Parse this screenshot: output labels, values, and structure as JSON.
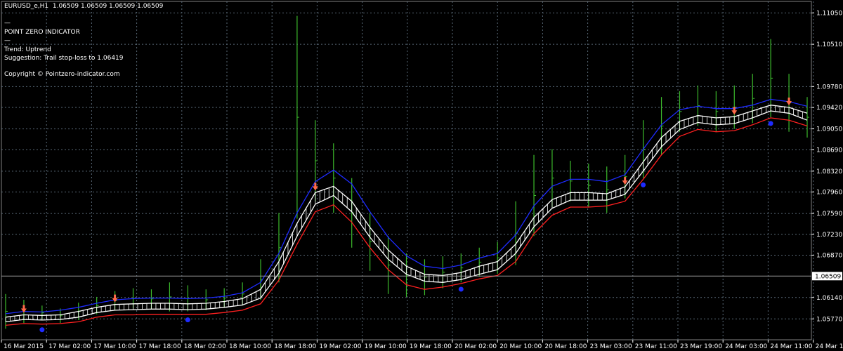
{
  "header": {
    "symbol_line": "EURUSD_e,H1  1.06509 1.06509 1.06509 1.06509",
    "sep1": "—",
    "indicator_name": "POINT ZERO INDICATOR",
    "sep2": "—",
    "trend": "Trend: Uptrend",
    "suggestion": "Suggestion: Trail stop-loss to 1.06419",
    "copyright": "Copyright © Pointzero-indicator.com"
  },
  "colors": {
    "background": "#000000",
    "grid": "#5a6a78",
    "bars": "#3cba2c",
    "upper_band": "#1e2bff",
    "lower_band": "#ff2020",
    "channel": "#ffffff",
    "up_arrow": "#ff6a4a",
    "down_dot": "#1e2bff",
    "axis_text": "#ffffff"
  },
  "chart_data": {
    "type": "line",
    "title": "EURUSD_e,H1",
    "current_price": 1.06509,
    "current_price_label": "1.06509",
    "ylim": [
      1.0541,
      1.1125
    ],
    "yticks": [
      "1.11050",
      "1.10510",
      "1.09780",
      "1.09420",
      "1.09050",
      "1.08690",
      "1.08320",
      "1.07960",
      "1.07590",
      "1.07230",
      "1.06870",
      "1.06140",
      "1.05770"
    ],
    "ytick_values": [
      1.1105,
      1.1051,
      1.0978,
      1.0942,
      1.0905,
      1.0869,
      1.0832,
      1.0796,
      1.0759,
      1.0723,
      1.0687,
      1.0614,
      1.0577
    ],
    "xticks": [
      "16 Mar 2015",
      "17 Mar 02:00",
      "17 Mar 10:00",
      "17 Mar 18:00",
      "18 Mar 02:00",
      "18 Mar 10:00",
      "18 Mar 18:00",
      "19 Mar 02:00",
      "19 Mar 10:00",
      "19 Mar 18:00",
      "20 Mar 02:00",
      "20 Mar 10:00",
      "20 Mar 18:00",
      "23 Mar 03:00",
      "23 Mar 11:00",
      "23 Mar 19:00",
      "24 Mar 03:00",
      "24 Mar 11:00",
      "24 Mar 19"
    ],
    "series": [
      {
        "name": "Upper band",
        "values": [
          1.0586,
          1.059,
          1.0589,
          1.0592,
          1.0597,
          1.0604,
          1.061,
          1.0612,
          1.0613,
          1.0613,
          1.0612,
          1.0613,
          1.0616,
          1.0622,
          1.064,
          1.069,
          1.076,
          1.0814,
          1.0834,
          1.081,
          1.0762,
          1.0718,
          1.0686,
          1.0668,
          1.0664,
          1.067,
          1.0682,
          1.069,
          1.0722,
          1.0772,
          1.0806,
          1.0818,
          1.0818,
          1.0814,
          1.0826,
          1.087,
          1.0912,
          1.0938,
          1.0944,
          1.094,
          1.094,
          1.0946,
          1.0956,
          1.0952,
          1.0944
        ]
      },
      {
        "name": "Channel upper",
        "values": [
          1.058,
          1.0584,
          1.0583,
          1.0584,
          1.059,
          1.0597,
          1.0602,
          1.0603,
          1.0604,
          1.0604,
          1.0603,
          1.0604,
          1.0607,
          1.0612,
          1.0628,
          1.0676,
          1.0742,
          1.0795,
          1.0806,
          1.078,
          1.0735,
          1.0696,
          1.0668,
          1.0654,
          1.0652,
          1.0657,
          1.0668,
          1.0676,
          1.0706,
          1.0752,
          1.0783,
          1.0795,
          1.0795,
          1.0793,
          1.0805,
          1.0848,
          1.089,
          1.0918,
          1.0928,
          1.0924,
          1.0926,
          1.0936,
          1.0946,
          1.0942,
          1.0932
        ]
      },
      {
        "name": "Channel lower",
        "values": [
          1.0572,
          1.0576,
          1.0575,
          1.0576,
          1.058,
          1.0588,
          1.0592,
          1.0593,
          1.0594,
          1.0594,
          1.0593,
          1.0594,
          1.0597,
          1.0601,
          1.0613,
          1.0656,
          1.072,
          1.0775,
          1.079,
          1.0762,
          1.0718,
          1.068,
          1.0654,
          1.0642,
          1.064,
          1.0645,
          1.0654,
          1.0662,
          1.069,
          1.0736,
          1.0768,
          1.0782,
          1.0782,
          1.0782,
          1.0792,
          1.0832,
          1.0874,
          1.0904,
          1.0916,
          1.0912,
          1.0914,
          1.0924,
          1.0936,
          1.0932,
          1.092
        ]
      },
      {
        "name": "Lower band",
        "values": [
          1.0566,
          1.0569,
          1.0568,
          1.0569,
          1.0572,
          1.058,
          1.0584,
          1.0584,
          1.0585,
          1.0585,
          1.0585,
          1.0585,
          1.0588,
          1.0592,
          1.0603,
          1.0644,
          1.0706,
          1.0762,
          1.0774,
          1.0744,
          1.07,
          1.0662,
          1.0636,
          1.0628,
          1.0632,
          1.0638,
          1.0646,
          1.0652,
          1.0676,
          1.0724,
          1.0756,
          1.077,
          1.077,
          1.0772,
          1.078,
          1.0818,
          1.086,
          1.0892,
          1.0904,
          1.09,
          1.0902,
          1.0912,
          1.0924,
          1.092,
          1.091
        ]
      }
    ],
    "bars": [
      {
        "high": 1.062,
        "low": 1.056
      },
      {
        "high": 1.061,
        "low": 1.057
      },
      {
        "high": 1.06,
        "low": 1.0575
      },
      {
        "high": 1.0595,
        "low": 1.057
      },
      {
        "high": 1.0605,
        "low": 1.0575
      },
      {
        "high": 1.0615,
        "low": 1.0585
      },
      {
        "high": 1.0625,
        "low": 1.0592
      },
      {
        "high": 1.063,
        "low": 1.0595
      },
      {
        "high": 1.0628,
        "low": 1.0595
      },
      {
        "high": 1.064,
        "low": 1.059
      },
      {
        "high": 1.0635,
        "low": 1.059
      },
      {
        "high": 1.0628,
        "low": 1.0592
      },
      {
        "high": 1.063,
        "low": 1.0596
      },
      {
        "high": 1.064,
        "low": 1.06
      },
      {
        "high": 1.068,
        "low": 1.061
      },
      {
        "high": 1.076,
        "low": 1.064
      },
      {
        "high": 1.11,
        "low": 1.075
      },
      {
        "high": 1.092,
        "low": 1.078
      },
      {
        "high": 1.088,
        "low": 1.076
      },
      {
        "high": 1.082,
        "low": 1.07
      },
      {
        "high": 1.076,
        "low": 1.066
      },
      {
        "high": 1.072,
        "low": 1.062
      },
      {
        "high": 1.069,
        "low": 1.0615
      },
      {
        "high": 1.068,
        "low": 1.0618
      },
      {
        "high": 1.0685,
        "low": 1.063
      },
      {
        "high": 1.069,
        "low": 1.064
      },
      {
        "high": 1.07,
        "low": 1.065
      },
      {
        "high": 1.071,
        "low": 1.0655
      },
      {
        "high": 1.078,
        "low": 1.067
      },
      {
        "high": 1.086,
        "low": 1.072
      },
      {
        "high": 1.087,
        "low": 1.077
      },
      {
        "high": 1.085,
        "low": 1.078
      },
      {
        "high": 1.0845,
        "low": 1.077
      },
      {
        "high": 1.084,
        "low": 1.076
      },
      {
        "high": 1.086,
        "low": 1.0785
      },
      {
        "high": 1.092,
        "low": 1.082
      },
      {
        "high": 1.096,
        "low": 1.086
      },
      {
        "high": 1.097,
        "low": 1.09
      },
      {
        "high": 1.098,
        "low": 1.091
      },
      {
        "high": 1.097,
        "low": 1.09
      },
      {
        "high": 1.098,
        "low": 1.0905
      },
      {
        "high": 1.1,
        "low": 1.0915
      },
      {
        "high": 1.106,
        "low": 1.0925
      },
      {
        "high": 1.1,
        "low": 1.09
      },
      {
        "high": 1.096,
        "low": 1.089
      }
    ],
    "up_arrows": [
      1,
      6,
      17,
      34,
      40,
      43
    ],
    "down_dots": [
      2,
      10,
      25,
      35,
      42
    ]
  }
}
